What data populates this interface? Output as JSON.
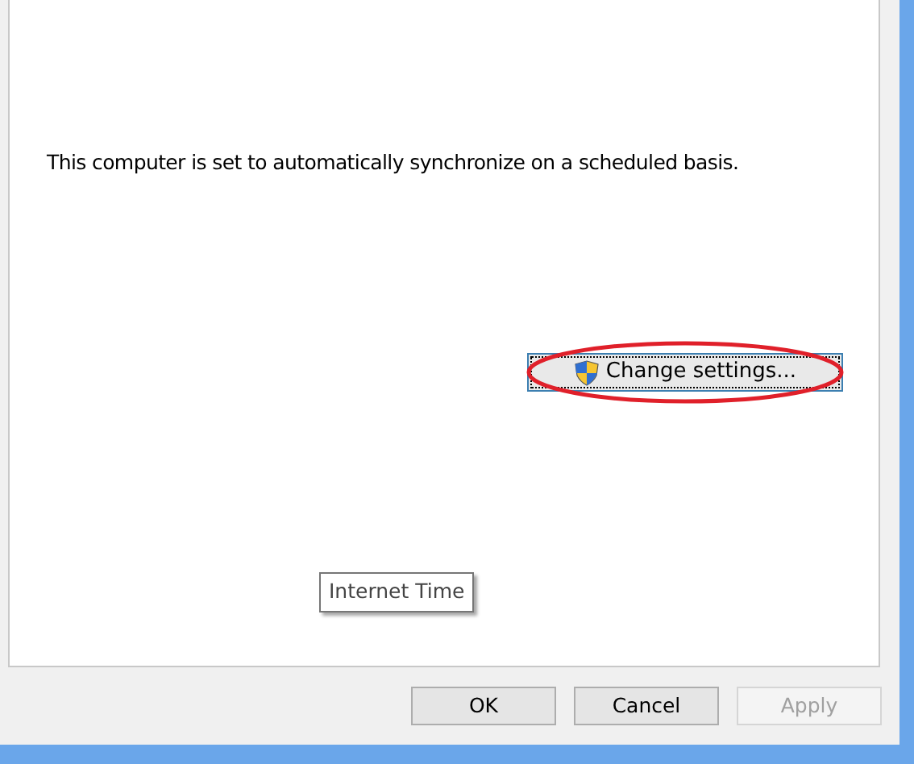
{
  "panel": {
    "message": "This computer is set to automatically synchronize on a scheduled basis.",
    "change_button": {
      "label": "Change settings...",
      "focused": true,
      "highlighted": true
    },
    "tooltip": "Internet Time"
  },
  "buttons": [
    {
      "label": "OK",
      "disabled": false
    },
    {
      "label": "Cancel",
      "disabled": false
    },
    {
      "label": "Apply",
      "disabled": true
    }
  ]
}
